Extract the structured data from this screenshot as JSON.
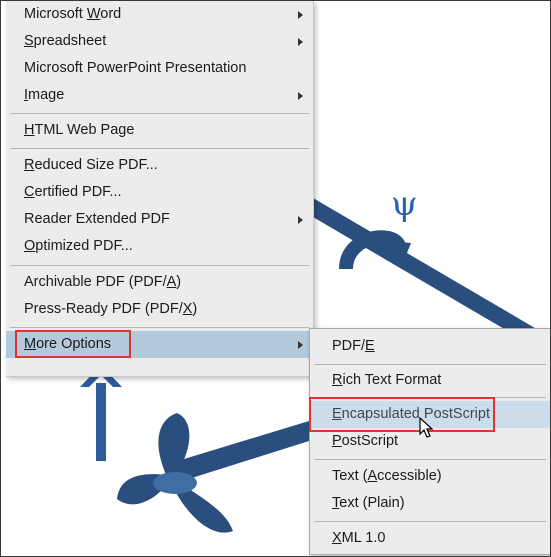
{
  "main_menu": {
    "items": [
      {
        "pre": "Microsoft ",
        "key": "W",
        "post": "ord",
        "submenu": true
      },
      {
        "pre": "",
        "key": "S",
        "post": "preadsheet",
        "submenu": true
      },
      {
        "pre": "Microsoft PowerPoint Presentation",
        "key": "",
        "post": "",
        "submenu": false
      },
      {
        "pre": "",
        "key": "I",
        "post": "mage",
        "submenu": true
      },
      {
        "pre": "",
        "key": "H",
        "post": "TML Web Page",
        "submenu": false
      },
      {
        "pre": "",
        "key": "R",
        "post": "educed Size PDF...",
        "submenu": false
      },
      {
        "pre": "",
        "key": "C",
        "post": "ertified PDF...",
        "submenu": false
      },
      {
        "pre": "Reader Extended PDF",
        "key": "",
        "post": "",
        "submenu": true
      },
      {
        "pre": "",
        "key": "O",
        "post": "ptimized PDF...",
        "submenu": false
      },
      {
        "pre": "Archivable PDF (PDF/",
        "key": "A",
        "post": ")",
        "submenu": false
      },
      {
        "pre": "Press-Ready PDF (PDF/",
        "key": "X",
        "post": ")",
        "submenu": false
      },
      {
        "pre": "",
        "key": "M",
        "post": "ore Options",
        "submenu": true
      }
    ]
  },
  "sub_menu": {
    "items": [
      {
        "pre": "PDF/",
        "key": "E",
        "post": ""
      },
      {
        "pre": "",
        "key": "R",
        "post": "ich Text Format"
      },
      {
        "pre": "",
        "key": "E",
        "post": "ncapsulated PostScript"
      },
      {
        "pre": "",
        "key": "P",
        "post": "ostScript"
      },
      {
        "pre": "Text (",
        "key": "A",
        "post": "ccessible)"
      },
      {
        "pre": "",
        "key": "T",
        "post": "ext (Plain)"
      },
      {
        "pre": "",
        "key": "X",
        "post": "ML 1.0"
      }
    ]
  },
  "colors": {
    "menu_bg": "#ececec",
    "hover": "#b3c9dc",
    "hover_light": "#cbdceb",
    "annotation_red": "#e33232",
    "drawing_blue": "#2a4f7e"
  },
  "icons": {
    "cursor": "mouse-pointer-icon",
    "annotation_arrow": "arrow-up-icon",
    "psi": "ψ"
  }
}
